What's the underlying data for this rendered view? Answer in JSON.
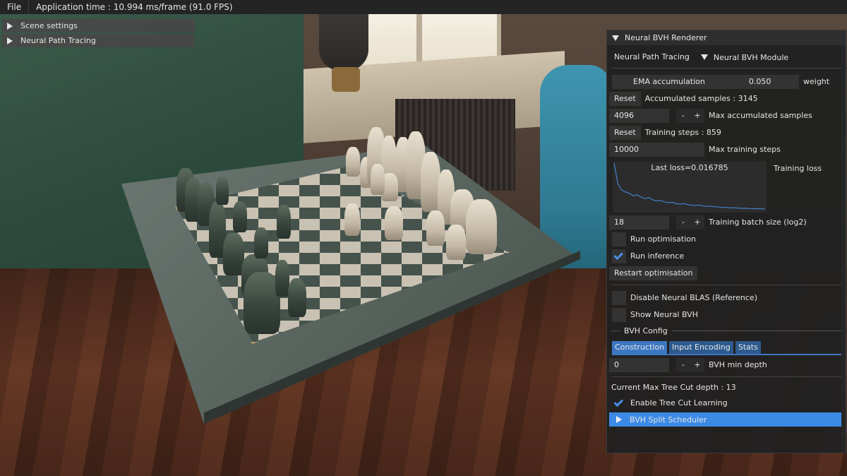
{
  "menubar": {
    "file_label": "File",
    "status": "Application time : 10.994 ms/frame (91.0 FPS)"
  },
  "left_panels": {
    "scene_settings": "Scene settings",
    "neural_path_tracing": "Neural Path Tracing"
  },
  "renderer": {
    "title": "Neural BVH Renderer",
    "tab_path_tracing": "Neural Path Tracing",
    "module_header": "Neural BVH Module",
    "ema_label": "EMA accumulation",
    "ema_value": "0.050",
    "ema_weight_label": "weight",
    "reset_label": "Reset",
    "accumulated_samples": "Accumulated samples : 3145",
    "max_samples_value": "4096",
    "minus": "-",
    "plus": "+",
    "max_samples_label": "Max accumulated samples",
    "reset2_label": "Reset",
    "training_steps": "Training steps : 859",
    "max_training_value": "10000",
    "max_training_label": "Max training steps",
    "last_loss": "Last loss=0.016785",
    "training_loss_label": "Training loss",
    "batch_value": "18",
    "batch_label": "Training batch size (log2)",
    "run_optimisation": "Run optimisation",
    "run_inference": "Run inference",
    "restart_optimisation": "Restart optimisation",
    "disable_blas": "Disable Neural BLAS (Reference)",
    "show_bvh": "Show Neural BVH",
    "bvh_config": "BVH Config",
    "tabs": [
      "Construction",
      "Input Encoding",
      "Stats"
    ],
    "min_depth_value": "0",
    "min_depth_label": "BVH min depth",
    "tree_cut_depth": "Current Max Tree Cut depth : 13",
    "enable_tree_cut": "Enable Tree Cut Learning",
    "split_scheduler": "BVH Split Scheduler"
  },
  "loss_curve": [
    1.0,
    0.55,
    0.42,
    0.38,
    0.35,
    0.3,
    0.32,
    0.27,
    0.24,
    0.26,
    0.21,
    0.19,
    0.2,
    0.17,
    0.15,
    0.16,
    0.13,
    0.12,
    0.13,
    0.11,
    0.1,
    0.09,
    0.1,
    0.08,
    0.07,
    0.08,
    0.06,
    0.06,
    0.05,
    0.05,
    0.04,
    0.045,
    0.035,
    0.03,
    0.032,
    0.025,
    0.022,
    0.02,
    0.018,
    0.016
  ],
  "colors": {
    "accent": "#3c77c2",
    "check": "#4a8fe8",
    "plot_line": "#4a8fe8"
  }
}
